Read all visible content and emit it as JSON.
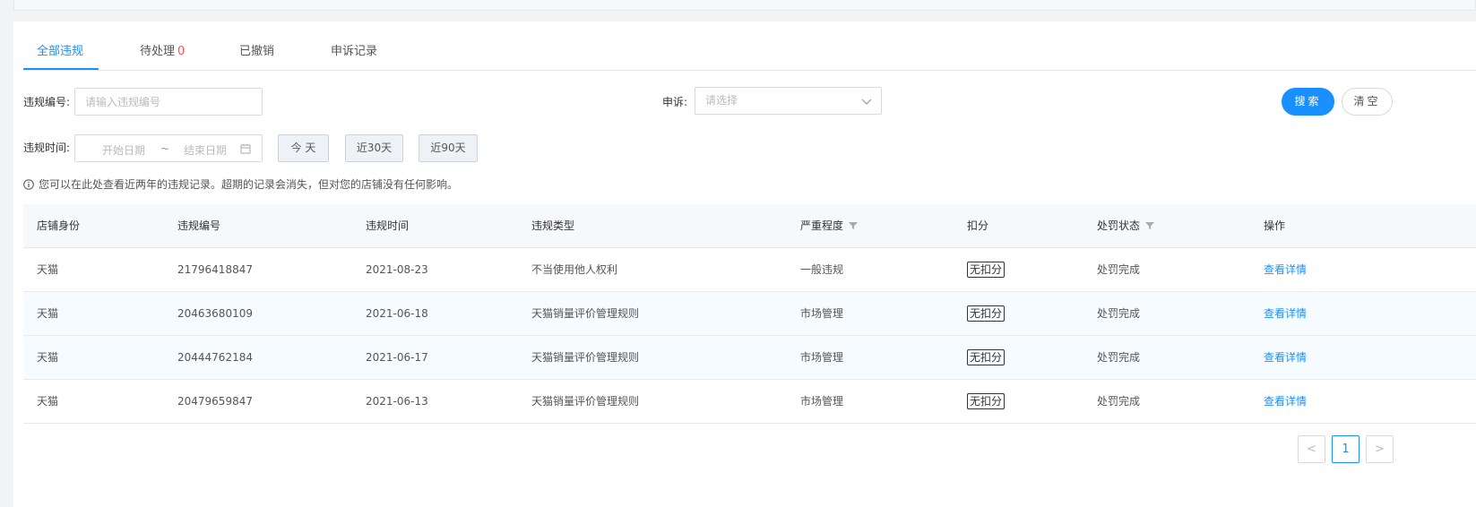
{
  "tabs": [
    {
      "label": "全部违规",
      "active": true
    },
    {
      "label": "待处理",
      "count": "0"
    },
    {
      "label": "已撤销"
    },
    {
      "label": "申诉记录"
    }
  ],
  "filters": {
    "violation_no_label": "违规编号:",
    "violation_no_placeholder": "请输入违规编号",
    "appeal_label": "申诉:",
    "appeal_placeholder": "请选择",
    "time_label": "违规时间:",
    "start_placeholder": "开始日期",
    "range_sep": "~",
    "end_placeholder": "结束日期",
    "quick": [
      "今 天",
      "近30天",
      "近90天"
    ],
    "search_label": "搜索",
    "clear_label": "清空"
  },
  "notice": "您可以在此处查看近两年的违规记录。超期的记录会消失，但对您的店铺没有任何影响。",
  "table": {
    "headers": [
      "店铺身份",
      "违规编号",
      "违规时间",
      "违规类型",
      "严重程度",
      "扣分",
      "处罚状态",
      "操作"
    ],
    "rows": [
      {
        "shop": "天猫",
        "no": "21796418847",
        "date": "2021-08-23",
        "type": "不当使用他人权利",
        "severity": "一般违规",
        "points": "无扣分",
        "status": "处罚完成",
        "action": "查看详情"
      },
      {
        "shop": "天猫",
        "no": "20463680109",
        "date": "2021-06-18",
        "type": "天猫销量评价管理规则",
        "severity": "市场管理",
        "points": "无扣分",
        "status": "处罚完成",
        "action": "查看详情"
      },
      {
        "shop": "天猫",
        "no": "20444762184",
        "date": "2021-06-17",
        "type": "天猫销量评价管理规则",
        "severity": "市场管理",
        "points": "无扣分",
        "status": "处罚完成",
        "action": "查看详情"
      },
      {
        "shop": "天猫",
        "no": "20479659847",
        "date": "2021-06-13",
        "type": "天猫销量评价管理规则",
        "severity": "市场管理",
        "points": "无扣分",
        "status": "处罚完成",
        "action": "查看详情"
      }
    ]
  },
  "pagination": {
    "prev": "<",
    "current": "1",
    "next": ">"
  },
  "colors": {
    "accent": "#1890ff",
    "count": "#ff4d4f",
    "row_alt": "#f5fbfe"
  }
}
